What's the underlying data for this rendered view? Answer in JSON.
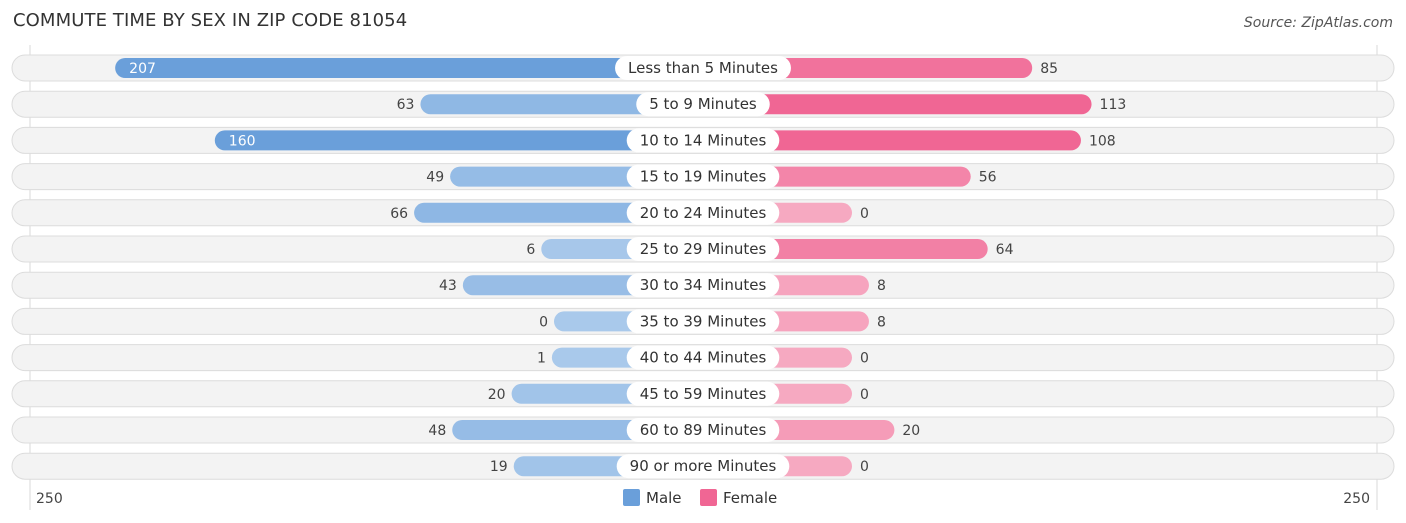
{
  "header": {
    "title": "COMMUTE TIME BY SEX IN ZIP CODE 81054",
    "source": "Source: ZipAtlas.com"
  },
  "colors": {
    "male_strong": "#6a9fda",
    "male_light": "#a9c9eb",
    "female_strong": "#f06694",
    "female_light": "#f6a9c1"
  },
  "chart_data": {
    "type": "bar",
    "orientation": "horizontal-diverging",
    "title": "COMMUTE TIME BY SEX IN ZIP CODE 81054",
    "categories": [
      "Less than 5 Minutes",
      "5 to 9 Minutes",
      "10 to 14 Minutes",
      "15 to 19 Minutes",
      "20 to 24 Minutes",
      "25 to 29 Minutes",
      "30 to 34 Minutes",
      "35 to 39 Minutes",
      "40 to 44 Minutes",
      "45 to 59 Minutes",
      "60 to 89 Minutes",
      "90 or more Minutes"
    ],
    "series": [
      {
        "name": "Male",
        "values": [
          207,
          63,
          160,
          49,
          66,
          6,
          43,
          0,
          1,
          20,
          48,
          19
        ]
      },
      {
        "name": "Female",
        "values": [
          85,
          113,
          108,
          56,
          0,
          64,
          8,
          8,
          0,
          0,
          20,
          0
        ]
      }
    ],
    "xlim": [
      -250,
      250
    ],
    "axis_tick_labels": {
      "left": "250",
      "right": "250"
    },
    "legend": {
      "position": "bottom-center",
      "entries": [
        "Male",
        "Female"
      ]
    },
    "grid": false
  }
}
